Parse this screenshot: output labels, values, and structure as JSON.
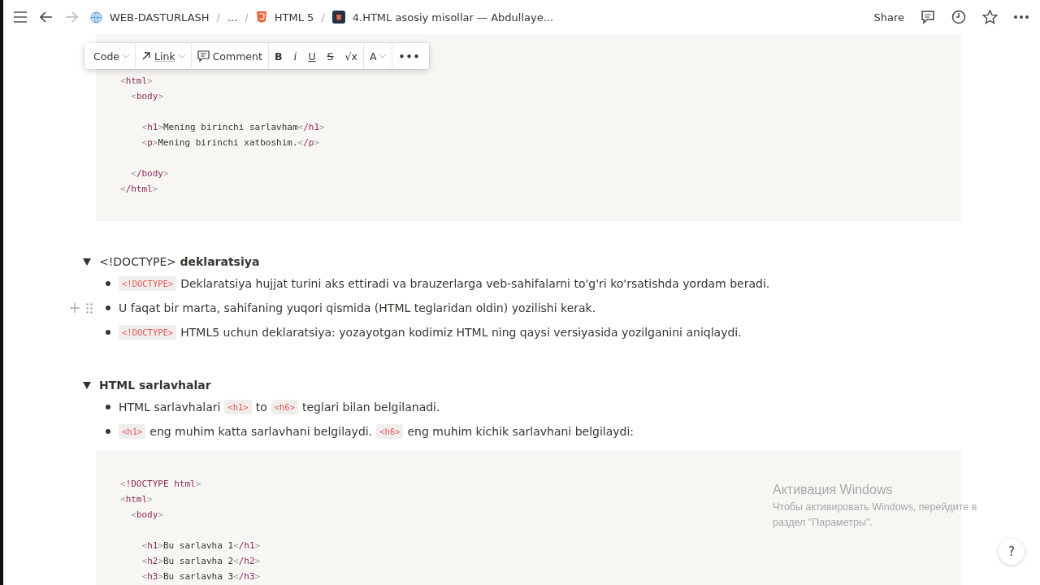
{
  "topbar": {
    "breadcrumbs": [
      {
        "kind": "globe",
        "label": "WEB-DASTURLASH"
      },
      {
        "kind": "none",
        "label": "..."
      },
      {
        "kind": "html5",
        "label": "HTML 5"
      },
      {
        "kind": "page",
        "label": "4.HTML asosiy misollar — Abdullaye..."
      }
    ],
    "separator": "/",
    "share": "Share"
  },
  "toolbar": [
    {
      "kind": "dropdown",
      "label": "Code"
    },
    {
      "kind": "link",
      "label": "Link"
    },
    {
      "kind": "comment",
      "label": "Comment"
    },
    {
      "kind": "bold",
      "label": "B"
    },
    {
      "kind": "italic",
      "label": "i"
    },
    {
      "kind": "underline",
      "label": "U"
    },
    {
      "kind": "strike",
      "label": "S"
    },
    {
      "kind": "plain",
      "label": "√x"
    },
    {
      "kind": "dropdown",
      "label": "A"
    },
    {
      "kind": "more",
      "label": "•••"
    }
  ],
  "code_block_1": [
    [
      "<html>",
      "  <body>"
    ],
    [
      "    <h1>Mening birinchi sarlavham</h1>",
      "    <p>Mening birinchi xatboshim.</p>"
    ],
    [
      "  </body>",
      "</html>"
    ]
  ],
  "sections": [
    {
      "heading": [
        {
          "kind": "text",
          "text": "<!DOCTYPE> "
        },
        {
          "kind": "bold",
          "text": "deklaratsiya"
        }
      ],
      "expanded": true,
      "bullets": [
        {
          "hover": false,
          "segments": [
            {
              "kind": "code",
              "text": "<!DOCTYPE>"
            },
            {
              "kind": "text",
              "text": "Deklaratsiya hujjat turini aks ettiradi va brauzerlarga veb-sahifalarni to'g'ri ko'rsatishda yordam beradi."
            }
          ]
        },
        {
          "hover": true,
          "segments": [
            {
              "kind": "text",
              "text": "U faqat bir marta, sahifaning yuqori qismida (HTML teglaridan oldin) yozilishi kerak."
            }
          ]
        },
        {
          "hover": false,
          "segments": [
            {
              "kind": "code",
              "text": "<!DOCTYPE>"
            },
            {
              "kind": "text",
              "text": "HTML5 uchun deklaratsiya: yozayotgan kodimiz HTML ning qaysi versiyasida yozilganini aniqlaydi."
            }
          ]
        }
      ]
    },
    {
      "heading": [
        {
          "kind": "bold",
          "text": "HTML sarlavhalar"
        }
      ],
      "expanded": true,
      "bullets": [
        {
          "hover": false,
          "segments": [
            {
              "kind": "text",
              "text": "HTML sarlavhalari"
            },
            {
              "kind": "code",
              "text": "<h1>"
            },
            {
              "kind": "text",
              "text": "to"
            },
            {
              "kind": "code",
              "text": "<h6>"
            },
            {
              "kind": "text",
              "text": "teglari bilan belgilanadi."
            }
          ]
        },
        {
          "hover": false,
          "segments": [
            {
              "kind": "code",
              "text": "<h1>"
            },
            {
              "kind": "text",
              "text": "eng muhim katta sarlavhani belgilaydi."
            },
            {
              "kind": "code",
              "text": "<h6>"
            },
            {
              "kind": "text",
              "text": "eng muhim kichik sarlavhani belgilaydi:"
            }
          ]
        }
      ]
    }
  ],
  "code_block_2": [
    [
      "<!DOCTYPE html>",
      "<html>",
      "  <body>"
    ],
    [
      "    <h1>Bu sarlavha 1</h1>",
      "    <h2>Bu sarlavha 2</h2>",
      "    <h3>Bu sarlavha 3</h3>"
    ]
  ],
  "activation": {
    "title": "Активация Windows",
    "message": "Чтобы активировать Windows, перейдите в раздел \"Параметры\"."
  },
  "help": "?"
}
